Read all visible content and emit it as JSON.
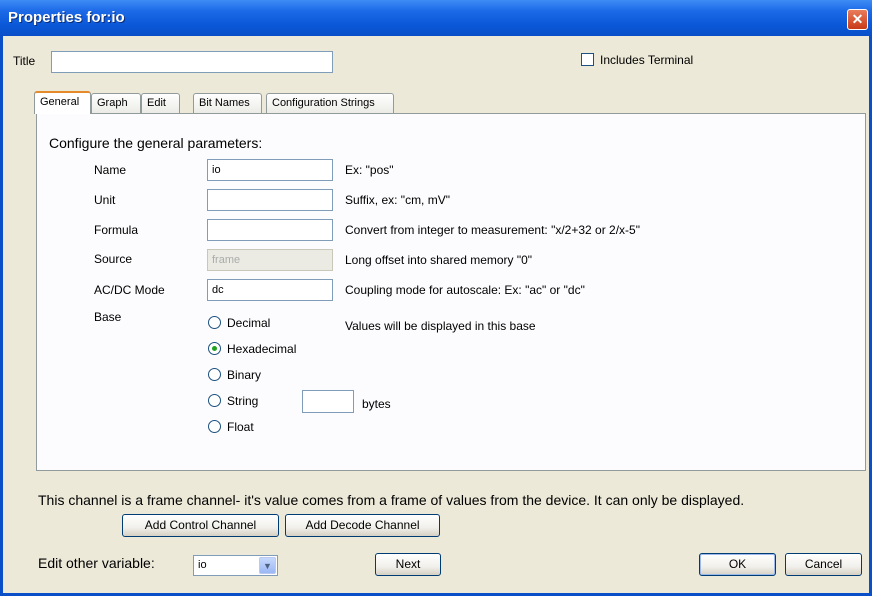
{
  "window": {
    "title": "Properties for:io",
    "close_glyph": "✕"
  },
  "header": {
    "title_label": "Title",
    "title_value": "",
    "includes_terminal_label": "Includes Terminal",
    "includes_terminal_checked": false
  },
  "tabs": [
    {
      "label": "General",
      "active": true
    },
    {
      "label": "Graph",
      "active": false
    },
    {
      "label": "Edit",
      "active": false
    },
    {
      "label": "Bit Names",
      "active": false
    },
    {
      "label": "Configuration Strings",
      "active": false
    }
  ],
  "general": {
    "heading": "Configure the general parameters:",
    "fields": {
      "name": {
        "label": "Name",
        "value": "io",
        "hint": "Ex: \"pos\""
      },
      "unit": {
        "label": "Unit",
        "value": "",
        "hint": "Suffix, ex: \"cm, mV\""
      },
      "formula": {
        "label": "Formula",
        "value": "",
        "hint": "Convert from integer to measurement: \"x/2+32 or 2/x-5\""
      },
      "source": {
        "label": "Source",
        "value": "frame",
        "hint": "Long offset into shared memory \"0\""
      },
      "acdc": {
        "label": "AC/DC Mode",
        "value": "dc",
        "hint": "Coupling mode for autoscale: Ex: \"ac\"  or \"dc\""
      }
    },
    "base": {
      "label": "Base",
      "hint": "Values will be displayed in this base",
      "options": [
        "Decimal",
        "Hexadecimal",
        "Binary",
        "String",
        "Float"
      ],
      "selected": "Hexadecimal",
      "bytes_label": "bytes",
      "bytes_value": ""
    }
  },
  "footer": {
    "info": "This channel is a frame channel- it's value comes from a frame of values from the device. It can only be displayed.",
    "add_control_label": "Add Control Channel",
    "add_decode_label": "Add Decode Channel",
    "edit_other_label": "Edit other variable:",
    "edit_other_value": "io",
    "next_label": "Next",
    "ok_label": "OK",
    "cancel_label": "Cancel"
  }
}
